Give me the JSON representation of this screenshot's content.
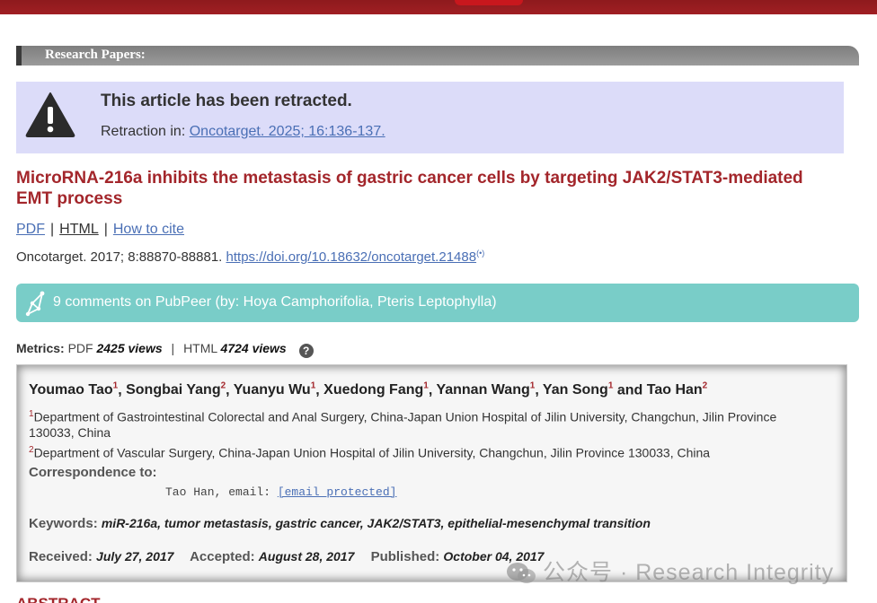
{
  "section": {
    "title": "Research Papers:"
  },
  "retraction": {
    "icon": "warning-icon",
    "title": "This article has been retracted.",
    "prefix": "Retraction in: ",
    "link_text": "Oncotarget. 2025; 16:136-137."
  },
  "article": {
    "title": "MicroRNA-216a inhibits the metastasis of gastric cancer cells by targeting JAK2/STAT3-mediated EMT process",
    "links": {
      "pdf": "PDF",
      "html": "HTML",
      "cite": "How to cite",
      "sep": "|"
    },
    "citation": "Oncotarget. 2017; 8:88870-88881. ",
    "doi": "https://doi.org/10.18632/oncotarget.21488",
    "doi_suffix": "(•)"
  },
  "pubpeer": {
    "icon": "pubpeer-icon",
    "text": "9 comments on PubPeer (by: Hoya Camphorifolia, Pteris Leptophylla)"
  },
  "metrics": {
    "label": "Metrics:",
    "pdf_label": "PDF",
    "pdf_views": "2425 views",
    "sep": "|",
    "html_label": "HTML",
    "html_views": "4724 views",
    "help": "?"
  },
  "authors": [
    {
      "name": "Youmao Tao",
      "aff": "1",
      "sep": ", "
    },
    {
      "name": "Songbai Yang",
      "aff": "2",
      "sep": ", "
    },
    {
      "name": "Yuanyu Wu",
      "aff": "1",
      "sep": ", "
    },
    {
      "name": "Xuedong Fang",
      "aff": "1",
      "sep": ", "
    },
    {
      "name": "Yannan Wang",
      "aff": "1",
      "sep": ", "
    },
    {
      "name": "Yan Song",
      "aff": "1",
      "sep": " and "
    },
    {
      "name": "Tao Han",
      "aff": "2",
      "sep": ""
    }
  ],
  "affiliations": [
    {
      "num": "1",
      "text": "Department of Gastrointestinal Colorectal and Anal Surgery, China-Japan Union Hospital of Jilin University, Changchun, Jilin Province 130033, China"
    },
    {
      "num": "2",
      "text": "Department of Vascular Surgery, China-Japan Union Hospital of Jilin University, Changchun, Jilin Province 130033, China"
    }
  ],
  "correspondence": {
    "label": "Correspondence to:",
    "line": "Tao Han, email: ",
    "email": "[email protected]"
  },
  "keywords": {
    "label": "Keywords:",
    "value": "miR-216a, tumor metastasis, gastric cancer, JAK2/STAT3, epithelial-mesenchymal transition"
  },
  "dates": {
    "received_label": "Received:",
    "received": "July 27, 2017",
    "accepted_label": "Accepted:",
    "accepted": "August 28, 2017",
    "published_label": "Published:",
    "published": "October 04, 2017"
  },
  "watermark": {
    "icon": "wechat-icon",
    "text": "公众号 · Research Integrity"
  },
  "abstract_heading": "ABSTRACT",
  "colors": {
    "title_red": "#a3262b",
    "link_blue": "#4a6fb5",
    "pubpeer_teal": "#79cdc8",
    "retract_bg": "#dcdcf9"
  }
}
